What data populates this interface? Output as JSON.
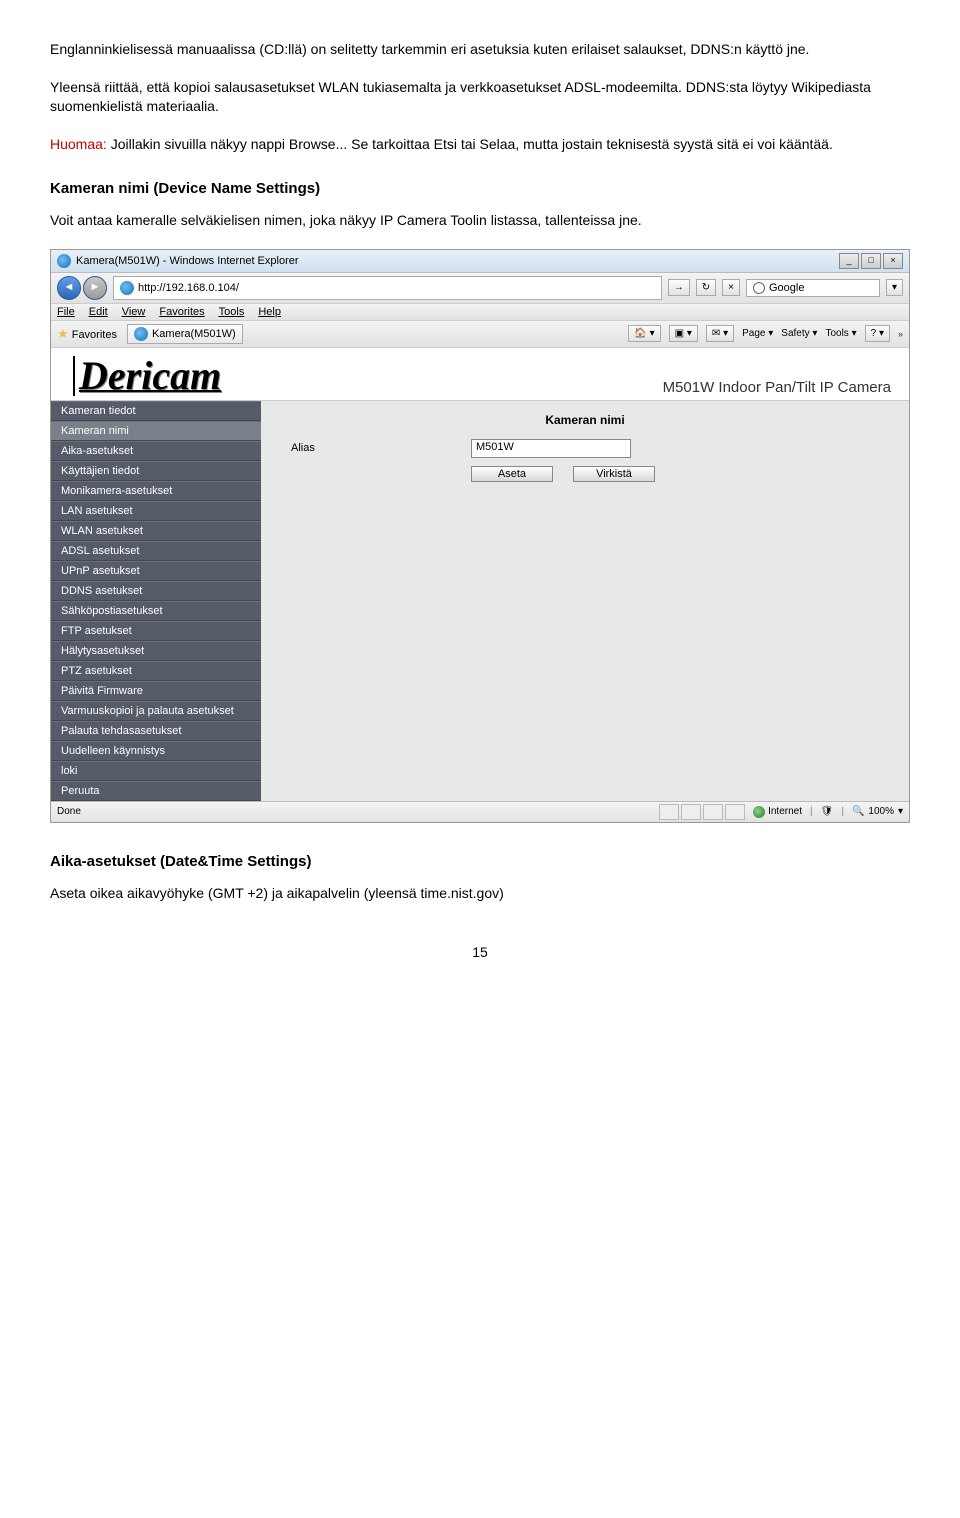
{
  "para1": "Englanninkielisessä manuaalissa (CD:llä) on selitetty tarkemmin eri asetuksia kuten erilaiset salaukset, DDNS:n käyttö jne.",
  "para2": "Yleensä riittää, että kopioi salausasetukset WLAN tukiasemalta ja verkkoasetukset ADSL-modeemilta. DDNS:sta löytyy Wikipediasta suomenkielistä materiaalia.",
  "note_prefix": "Huomaa:",
  "note_rest": " Joillakin sivuilla näkyy nappi Browse... Se tarkoittaa Etsi tai Selaa, mutta jostain teknisestä syystä sitä ei voi kääntää.",
  "heading_device": "Kameran nimi (Device Name Settings)",
  "device_desc": "Voit antaa kameralle selväkielisen nimen, joka näkyy IP Camera Toolin listassa, tallenteissa jne.",
  "browser": {
    "title": "Kamera(M501W) - Windows Internet Explorer",
    "url": "http://192.168.0.104/",
    "search_engine": "Google",
    "menu": [
      "File",
      "Edit",
      "View",
      "Favorites",
      "Tools",
      "Help"
    ],
    "fav_label": "Favorites",
    "tab_label": "Kamera(M501W)",
    "tool_items": [
      "Page",
      "Safety",
      "Tools"
    ],
    "logo_text": "Dericam",
    "model_text": "M501W Indoor Pan/Tilt IP Camera",
    "sidebar_items": [
      "Kameran tiedot",
      "Kameran nimi",
      "Aika-asetukset",
      "Käyttäjien tiedot",
      "Monikamera-asetukset",
      "LAN asetukset",
      "WLAN asetukset",
      "ADSL asetukset",
      "UPnP asetukset",
      "DDNS asetukset",
      "Sähköpostiasetukset",
      "FTP asetukset",
      "Hälytysasetukset",
      "PTZ asetukset",
      "Päivitä Firmware",
      "Varmuuskopioi ja palauta asetukset",
      "Palauta tehdasasetukset",
      "Uudelleen käynnistys",
      "loki",
      "Peruuta"
    ],
    "panel_title": "Kameran nimi",
    "alias_label": "Alias",
    "alias_value": "M501W",
    "btn_set": "Aseta",
    "btn_refresh": "Virkistä",
    "status_done": "Done",
    "status_zone": "Internet",
    "zoom": "100%"
  },
  "heading_datetime": "Aika-asetukset (Date&Time Settings)",
  "datetime_desc": "Aseta oikea aikavyöhyke (GMT +2) ja aikapalvelin (yleensä time.nist.gov)",
  "page_number": "15"
}
